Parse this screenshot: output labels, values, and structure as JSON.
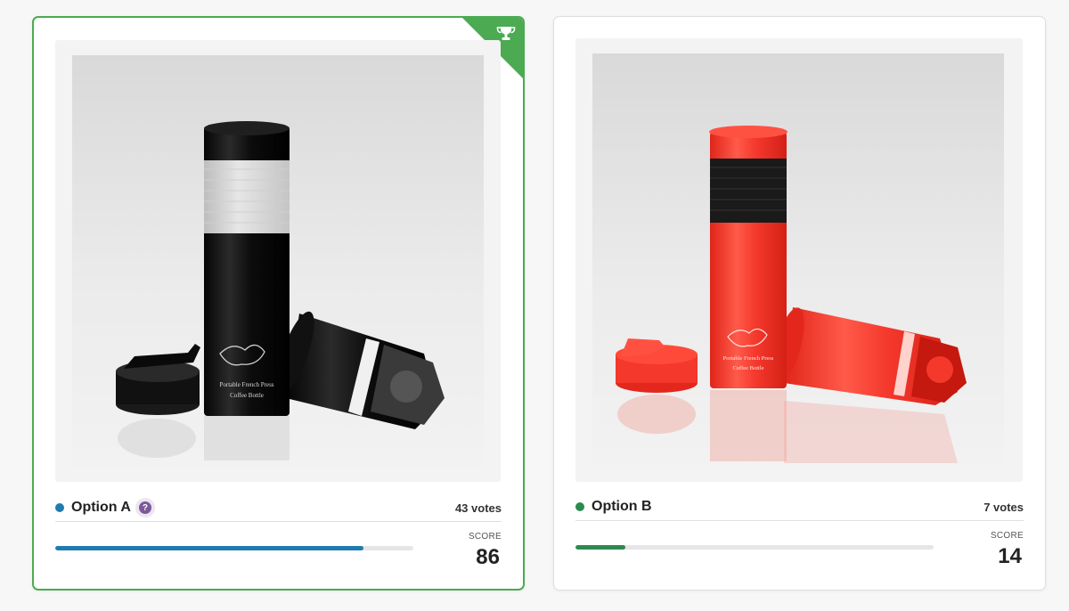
{
  "options": [
    {
      "name": "Option A",
      "votes_text": "43 votes",
      "score_label": "SCORE",
      "score": "86",
      "progress_fraction": 0.86,
      "dot_color": "#1f7bb0",
      "bar_color": "#1f7bb0",
      "winner": true,
      "help_glyph": "?",
      "bottle_print": [
        "Portable French Press",
        "Coffee Bottle"
      ]
    },
    {
      "name": "Option B",
      "votes_text": "7 votes",
      "score_label": "SCORE",
      "score": "14",
      "progress_fraction": 0.14,
      "dot_color": "#2d8a4e",
      "bar_color": "#2d8a4e",
      "winner": false,
      "bottle_print": [
        "Portable French Press",
        "Coffee Bottle"
      ]
    }
  ],
  "icons": {
    "winner_badge": "trophy-icon",
    "help": "question-icon"
  },
  "colors": {
    "winner_border": "#4caa52",
    "product_a": "#111111",
    "product_b": "#f4382c"
  }
}
